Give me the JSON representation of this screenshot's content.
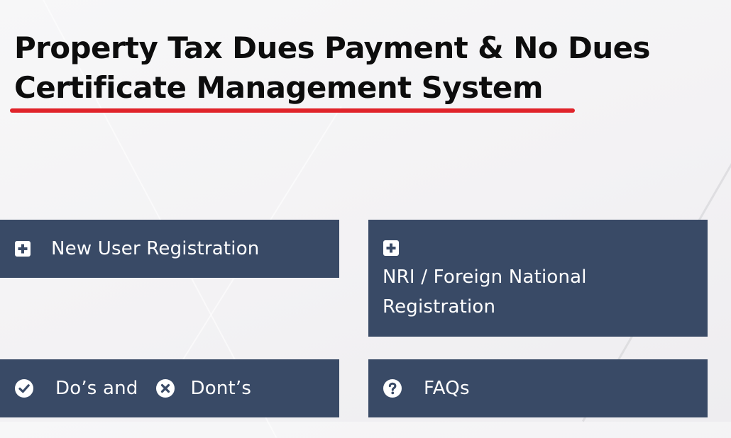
{
  "header": {
    "title_line1": "Property Tax Dues Payment & No Dues",
    "title_line2": "Certificate Management System",
    "underline_color": "#e0232a"
  },
  "cards": {
    "background_color": "#394a66",
    "new_user": {
      "label": "New User Registration",
      "icon": "plus-square-icon"
    },
    "nri": {
      "label": "NRI / Foreign National Registration",
      "icon": "plus-square-icon"
    },
    "dos_donts": {
      "dos_label": "Do’s and",
      "dos_icon": "check-circle-icon",
      "donts_label": "Dont’s",
      "donts_icon": "x-circle-icon"
    },
    "faqs": {
      "label": "FAQs",
      "icon": "question-circle-icon"
    }
  }
}
